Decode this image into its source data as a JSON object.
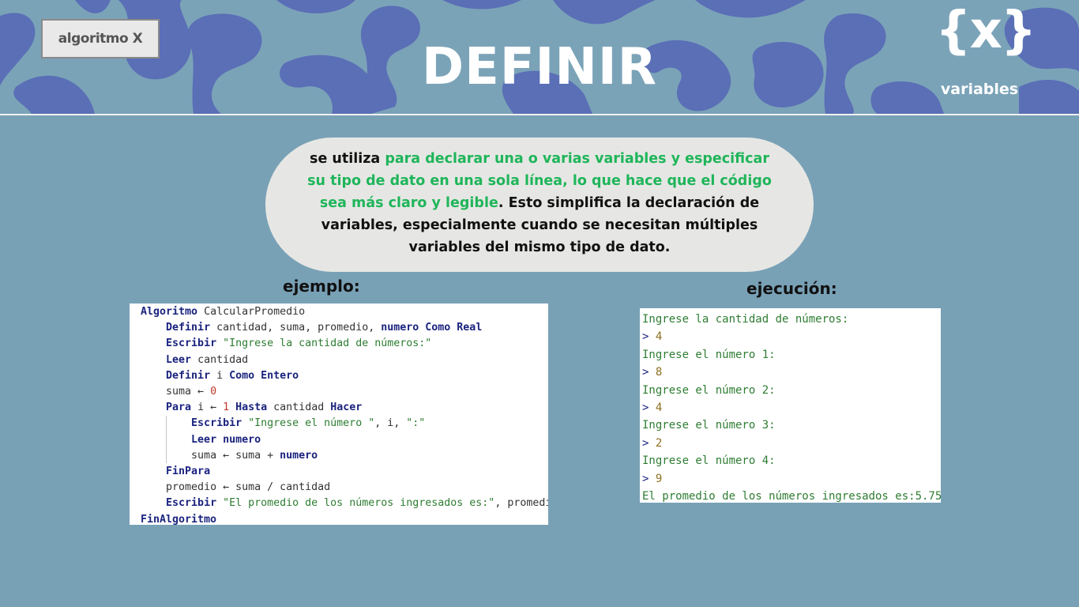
{
  "header": {
    "tag_label": "algoritmo X",
    "title": "DEFINIR",
    "logo_symbol": "{x}",
    "logo_label": "variables"
  },
  "description": {
    "part1": "se utiliza ",
    "part2_highlight": "para declarar una o varias variables y especificar su tipo de dato en una sola línea, lo que hace que el código sea más claro y legible",
    "part3": ". Esto simplifica la declaración de variables, especialmente cuando se necesitan múltiples variables del mismo tipo de dato."
  },
  "example_label": "ejemplo:",
  "execution_label": "ejecución:",
  "code": {
    "l1_kw": "Algoritmo",
    "l1_txt": " CalcularPromedio",
    "l2_kw": "Definir",
    "l2_txt": " cantidad, suma, promedio, ",
    "l2_kw2": "numero Como Real",
    "l3_kw": "Escribir",
    "l3_str": " \"Ingrese la cantidad de números:\"",
    "l4_kw": "Leer",
    "l4_txt": " cantidad",
    "l5_kw": "Definir",
    "l5_txt": " i ",
    "l5_kw2": "Como Entero",
    "l6_txt": "suma ← ",
    "l6_num": "0",
    "l7_kw": "Para",
    "l7_txt": " i ← ",
    "l7_num": "1",
    "l7_kw2": " Hasta",
    "l7_txt2": " cantidad ",
    "l7_kw3": "Hacer",
    "l8_kw": "Escribir",
    "l8_str": " \"Ingrese el número \"",
    "l8_txt": ", i, ",
    "l8_str2": "\":\"",
    "l9_kw": "Leer numero",
    "l10_txt": "suma ← suma + ",
    "l10_kw": "numero",
    "l11_kw": "FinPara",
    "l12_txt": "promedio ← suma / cantidad",
    "l13_kw": "Escribir",
    "l13_str": " \"El promedio de los números ingresados es:\"",
    "l13_txt": ", promedio",
    "l14_kw": "FinAlgoritmo"
  },
  "execution": {
    "r1": "Ingrese la cantidad de números:",
    "r2_prompt": "> ",
    "r2_val": "4",
    "r3": "Ingrese el número 1:",
    "r4_prompt": "> ",
    "r4_val": "8",
    "r5": "Ingrese el número 2:",
    "r6_prompt": "> ",
    "r6_val": "4",
    "r7": "Ingrese el número 3:",
    "r8_prompt": "> ",
    "r8_val": "2",
    "r9": "Ingrese el número 4:",
    "r10_prompt": "> ",
    "r10_val": "9",
    "r11": "El promedio de los números ingresados es:5.75"
  },
  "colors": {
    "background": "#79a1b6",
    "pattern": "#5870b5",
    "highlight": "#1fb55a"
  }
}
